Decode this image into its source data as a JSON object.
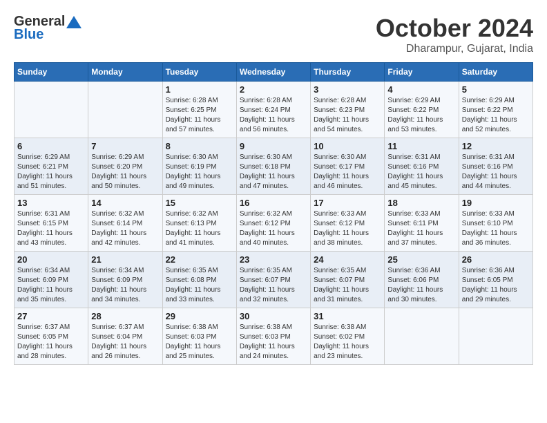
{
  "logo": {
    "general": "General",
    "blue": "Blue"
  },
  "header": {
    "month": "October 2024",
    "location": "Dharampur, Gujarat, India"
  },
  "weekdays": [
    "Sunday",
    "Monday",
    "Tuesday",
    "Wednesday",
    "Thursday",
    "Friday",
    "Saturday"
  ],
  "weeks": [
    [
      null,
      null,
      {
        "day": "1",
        "sunrise": "Sunrise: 6:28 AM",
        "sunset": "Sunset: 6:25 PM",
        "daylight": "Daylight: 11 hours and 57 minutes."
      },
      {
        "day": "2",
        "sunrise": "Sunrise: 6:28 AM",
        "sunset": "Sunset: 6:24 PM",
        "daylight": "Daylight: 11 hours and 56 minutes."
      },
      {
        "day": "3",
        "sunrise": "Sunrise: 6:28 AM",
        "sunset": "Sunset: 6:23 PM",
        "daylight": "Daylight: 11 hours and 54 minutes."
      },
      {
        "day": "4",
        "sunrise": "Sunrise: 6:29 AM",
        "sunset": "Sunset: 6:22 PM",
        "daylight": "Daylight: 11 hours and 53 minutes."
      },
      {
        "day": "5",
        "sunrise": "Sunrise: 6:29 AM",
        "sunset": "Sunset: 6:22 PM",
        "daylight": "Daylight: 11 hours and 52 minutes."
      }
    ],
    [
      {
        "day": "6",
        "sunrise": "Sunrise: 6:29 AM",
        "sunset": "Sunset: 6:21 PM",
        "daylight": "Daylight: 11 hours and 51 minutes."
      },
      {
        "day": "7",
        "sunrise": "Sunrise: 6:29 AM",
        "sunset": "Sunset: 6:20 PM",
        "daylight": "Daylight: 11 hours and 50 minutes."
      },
      {
        "day": "8",
        "sunrise": "Sunrise: 6:30 AM",
        "sunset": "Sunset: 6:19 PM",
        "daylight": "Daylight: 11 hours and 49 minutes."
      },
      {
        "day": "9",
        "sunrise": "Sunrise: 6:30 AM",
        "sunset": "Sunset: 6:18 PM",
        "daylight": "Daylight: 11 hours and 47 minutes."
      },
      {
        "day": "10",
        "sunrise": "Sunrise: 6:30 AM",
        "sunset": "Sunset: 6:17 PM",
        "daylight": "Daylight: 11 hours and 46 minutes."
      },
      {
        "day": "11",
        "sunrise": "Sunrise: 6:31 AM",
        "sunset": "Sunset: 6:16 PM",
        "daylight": "Daylight: 11 hours and 45 minutes."
      },
      {
        "day": "12",
        "sunrise": "Sunrise: 6:31 AM",
        "sunset": "Sunset: 6:16 PM",
        "daylight": "Daylight: 11 hours and 44 minutes."
      }
    ],
    [
      {
        "day": "13",
        "sunrise": "Sunrise: 6:31 AM",
        "sunset": "Sunset: 6:15 PM",
        "daylight": "Daylight: 11 hours and 43 minutes."
      },
      {
        "day": "14",
        "sunrise": "Sunrise: 6:32 AM",
        "sunset": "Sunset: 6:14 PM",
        "daylight": "Daylight: 11 hours and 42 minutes."
      },
      {
        "day": "15",
        "sunrise": "Sunrise: 6:32 AM",
        "sunset": "Sunset: 6:13 PM",
        "daylight": "Daylight: 11 hours and 41 minutes."
      },
      {
        "day": "16",
        "sunrise": "Sunrise: 6:32 AM",
        "sunset": "Sunset: 6:12 PM",
        "daylight": "Daylight: 11 hours and 40 minutes."
      },
      {
        "day": "17",
        "sunrise": "Sunrise: 6:33 AM",
        "sunset": "Sunset: 6:12 PM",
        "daylight": "Daylight: 11 hours and 38 minutes."
      },
      {
        "day": "18",
        "sunrise": "Sunrise: 6:33 AM",
        "sunset": "Sunset: 6:11 PM",
        "daylight": "Daylight: 11 hours and 37 minutes."
      },
      {
        "day": "19",
        "sunrise": "Sunrise: 6:33 AM",
        "sunset": "Sunset: 6:10 PM",
        "daylight": "Daylight: 11 hours and 36 minutes."
      }
    ],
    [
      {
        "day": "20",
        "sunrise": "Sunrise: 6:34 AM",
        "sunset": "Sunset: 6:09 PM",
        "daylight": "Daylight: 11 hours and 35 minutes."
      },
      {
        "day": "21",
        "sunrise": "Sunrise: 6:34 AM",
        "sunset": "Sunset: 6:09 PM",
        "daylight": "Daylight: 11 hours and 34 minutes."
      },
      {
        "day": "22",
        "sunrise": "Sunrise: 6:35 AM",
        "sunset": "Sunset: 6:08 PM",
        "daylight": "Daylight: 11 hours and 33 minutes."
      },
      {
        "day": "23",
        "sunrise": "Sunrise: 6:35 AM",
        "sunset": "Sunset: 6:07 PM",
        "daylight": "Daylight: 11 hours and 32 minutes."
      },
      {
        "day": "24",
        "sunrise": "Sunrise: 6:35 AM",
        "sunset": "Sunset: 6:07 PM",
        "daylight": "Daylight: 11 hours and 31 minutes."
      },
      {
        "day": "25",
        "sunrise": "Sunrise: 6:36 AM",
        "sunset": "Sunset: 6:06 PM",
        "daylight": "Daylight: 11 hours and 30 minutes."
      },
      {
        "day": "26",
        "sunrise": "Sunrise: 6:36 AM",
        "sunset": "Sunset: 6:05 PM",
        "daylight": "Daylight: 11 hours and 29 minutes."
      }
    ],
    [
      {
        "day": "27",
        "sunrise": "Sunrise: 6:37 AM",
        "sunset": "Sunset: 6:05 PM",
        "daylight": "Daylight: 11 hours and 28 minutes."
      },
      {
        "day": "28",
        "sunrise": "Sunrise: 6:37 AM",
        "sunset": "Sunset: 6:04 PM",
        "daylight": "Daylight: 11 hours and 26 minutes."
      },
      {
        "day": "29",
        "sunrise": "Sunrise: 6:38 AM",
        "sunset": "Sunset: 6:03 PM",
        "daylight": "Daylight: 11 hours and 25 minutes."
      },
      {
        "day": "30",
        "sunrise": "Sunrise: 6:38 AM",
        "sunset": "Sunset: 6:03 PM",
        "daylight": "Daylight: 11 hours and 24 minutes."
      },
      {
        "day": "31",
        "sunrise": "Sunrise: 6:38 AM",
        "sunset": "Sunset: 6:02 PM",
        "daylight": "Daylight: 11 hours and 23 minutes."
      },
      null,
      null
    ]
  ]
}
